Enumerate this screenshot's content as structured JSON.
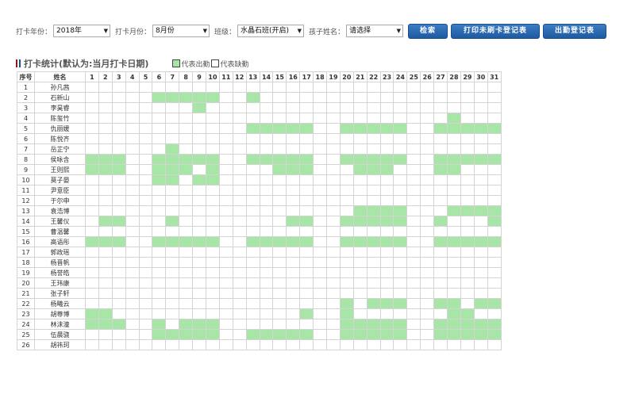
{
  "toolbar": {
    "year_label": "打卡年份：",
    "year_value": "2018年",
    "month_label": "打卡月份：",
    "month_value": "8月份",
    "class_label": "班级：",
    "class_value": "水晶石班(开启)",
    "child_label": "孩子姓名：",
    "child_value": "请选择",
    "search_button": "检索",
    "print_button": "打印未刷卡登记表",
    "attendance_button": "出勤登记表"
  },
  "section": {
    "title": "打卡统计(默认为:当月打卡日期)",
    "legend_present": "代表出勤",
    "legend_absent": "代表缺勤"
  },
  "colors": {
    "present": "#a8e6a8",
    "absent": "#ffffff",
    "button": "#1e5aa0",
    "title_mark_red": "#8b1a1a",
    "title_mark_blue": "#1e4f8c"
  },
  "table": {
    "col_index": "序号",
    "col_name": "姓名",
    "days": [
      "1",
      "2",
      "3",
      "4",
      "5",
      "6",
      "7",
      "8",
      "9",
      "10",
      "11",
      "12",
      "13",
      "14",
      "15",
      "16",
      "17",
      "18",
      "19",
      "20",
      "21",
      "22",
      "23",
      "24",
      "25",
      "26",
      "27",
      "28",
      "29",
      "30",
      "31"
    ],
    "rows": [
      {
        "index": "1",
        "name": "孙凡茜",
        "present": []
      },
      {
        "index": "2",
        "name": "石新山",
        "present": [
          6,
          7,
          8,
          9,
          10,
          13
        ]
      },
      {
        "index": "3",
        "name": "李昊睿",
        "present": [
          9
        ]
      },
      {
        "index": "4",
        "name": "陈玺竹",
        "present": [
          28
        ]
      },
      {
        "index": "5",
        "name": "仇丽媛",
        "present": [
          13,
          14,
          15,
          16,
          17,
          20,
          21,
          22,
          23,
          24,
          27,
          28,
          29,
          30,
          31
        ]
      },
      {
        "index": "6",
        "name": "陈悦齐",
        "present": []
      },
      {
        "index": "7",
        "name": "岳芷宁",
        "present": [
          7
        ]
      },
      {
        "index": "8",
        "name": "侯咏含",
        "present": [
          1,
          2,
          3,
          6,
          7,
          8,
          9,
          10,
          13,
          14,
          15,
          16,
          17,
          20,
          21,
          22,
          23,
          24,
          27,
          28,
          29,
          30,
          31
        ]
      },
      {
        "index": "9",
        "name": "王则熙",
        "present": [
          1,
          2,
          3,
          6,
          7,
          8,
          10,
          15,
          16,
          17,
          21,
          22,
          23,
          27,
          28
        ]
      },
      {
        "index": "10",
        "name": "莫子晏",
        "present": [
          6,
          7,
          9,
          10
        ]
      },
      {
        "index": "11",
        "name": "尹意臣",
        "present": []
      },
      {
        "index": "12",
        "name": "于尔申",
        "present": []
      },
      {
        "index": "13",
        "name": "袁浩博",
        "present": [
          21,
          22,
          23,
          24,
          28,
          29,
          30,
          31
        ]
      },
      {
        "index": "14",
        "name": "王馨仪",
        "present": [
          2,
          3,
          7,
          16,
          17,
          20,
          21,
          22,
          23,
          24,
          27,
          31
        ]
      },
      {
        "index": "15",
        "name": "曹温馨",
        "present": []
      },
      {
        "index": "16",
        "name": "高语彤",
        "present": [
          1,
          2,
          3,
          6,
          7,
          8,
          9,
          10,
          13,
          14,
          15,
          16,
          17,
          20,
          21,
          22,
          23,
          24,
          27,
          28,
          29,
          30,
          31
        ]
      },
      {
        "index": "17",
        "name": "郭政瑶",
        "present": []
      },
      {
        "index": "18",
        "name": "杨晋帆",
        "present": []
      },
      {
        "index": "19",
        "name": "杨誉皓",
        "present": []
      },
      {
        "index": "20",
        "name": "王玮康",
        "present": []
      },
      {
        "index": "21",
        "name": "张子轩",
        "present": []
      },
      {
        "index": "22",
        "name": "杨曦云",
        "present": [
          20,
          22,
          23,
          24,
          27,
          28,
          30,
          31
        ]
      },
      {
        "index": "23",
        "name": "胡尊博",
        "present": [
          1,
          2,
          17,
          20,
          28,
          29
        ]
      },
      {
        "index": "24",
        "name": "林沫潼",
        "present": [
          1,
          2,
          3,
          6,
          8,
          9,
          10,
          20,
          21,
          22,
          23,
          24,
          27,
          28,
          29,
          30,
          31
        ]
      },
      {
        "index": "25",
        "name": "伍晨骁",
        "present": [
          6,
          7,
          8,
          9,
          10,
          13,
          14,
          15,
          16,
          17,
          20,
          21,
          22,
          23,
          24,
          27,
          28,
          29,
          30,
          31
        ]
      },
      {
        "index": "26",
        "name": "胡祎珂",
        "present": []
      }
    ]
  }
}
